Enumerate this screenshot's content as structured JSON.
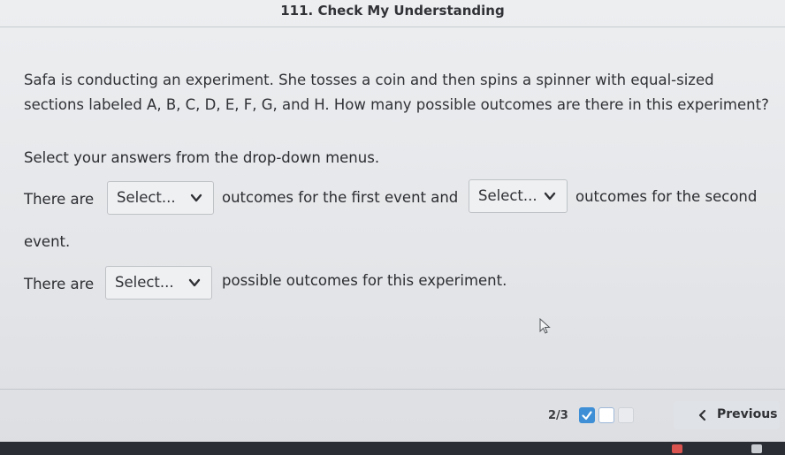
{
  "header": {
    "title": "111. Check My Understanding"
  },
  "question": {
    "text": "Safa is conducting an experiment. She tosses a coin and then spins a spinner with equal-sized sections labeled A, B, C, D, E, F, G, and H. How many possible outcomes are there in this experiment?"
  },
  "instructions": "Select your answers from the drop-down menus.",
  "sentence1": {
    "part1": "There are",
    "select1": "Select...",
    "part2": "outcomes for the first event and",
    "select2": "Select...",
    "part3": "outcomes for the second",
    "part4": "event."
  },
  "sentence2": {
    "part1": "There are",
    "select": "Select...",
    "part2": "possible outcomes for this experiment."
  },
  "footer": {
    "progress": "2/3",
    "previous_label": "Previous"
  },
  "colors": {
    "accent": "#3f8fd6",
    "taskbar": "#2a2d33"
  }
}
